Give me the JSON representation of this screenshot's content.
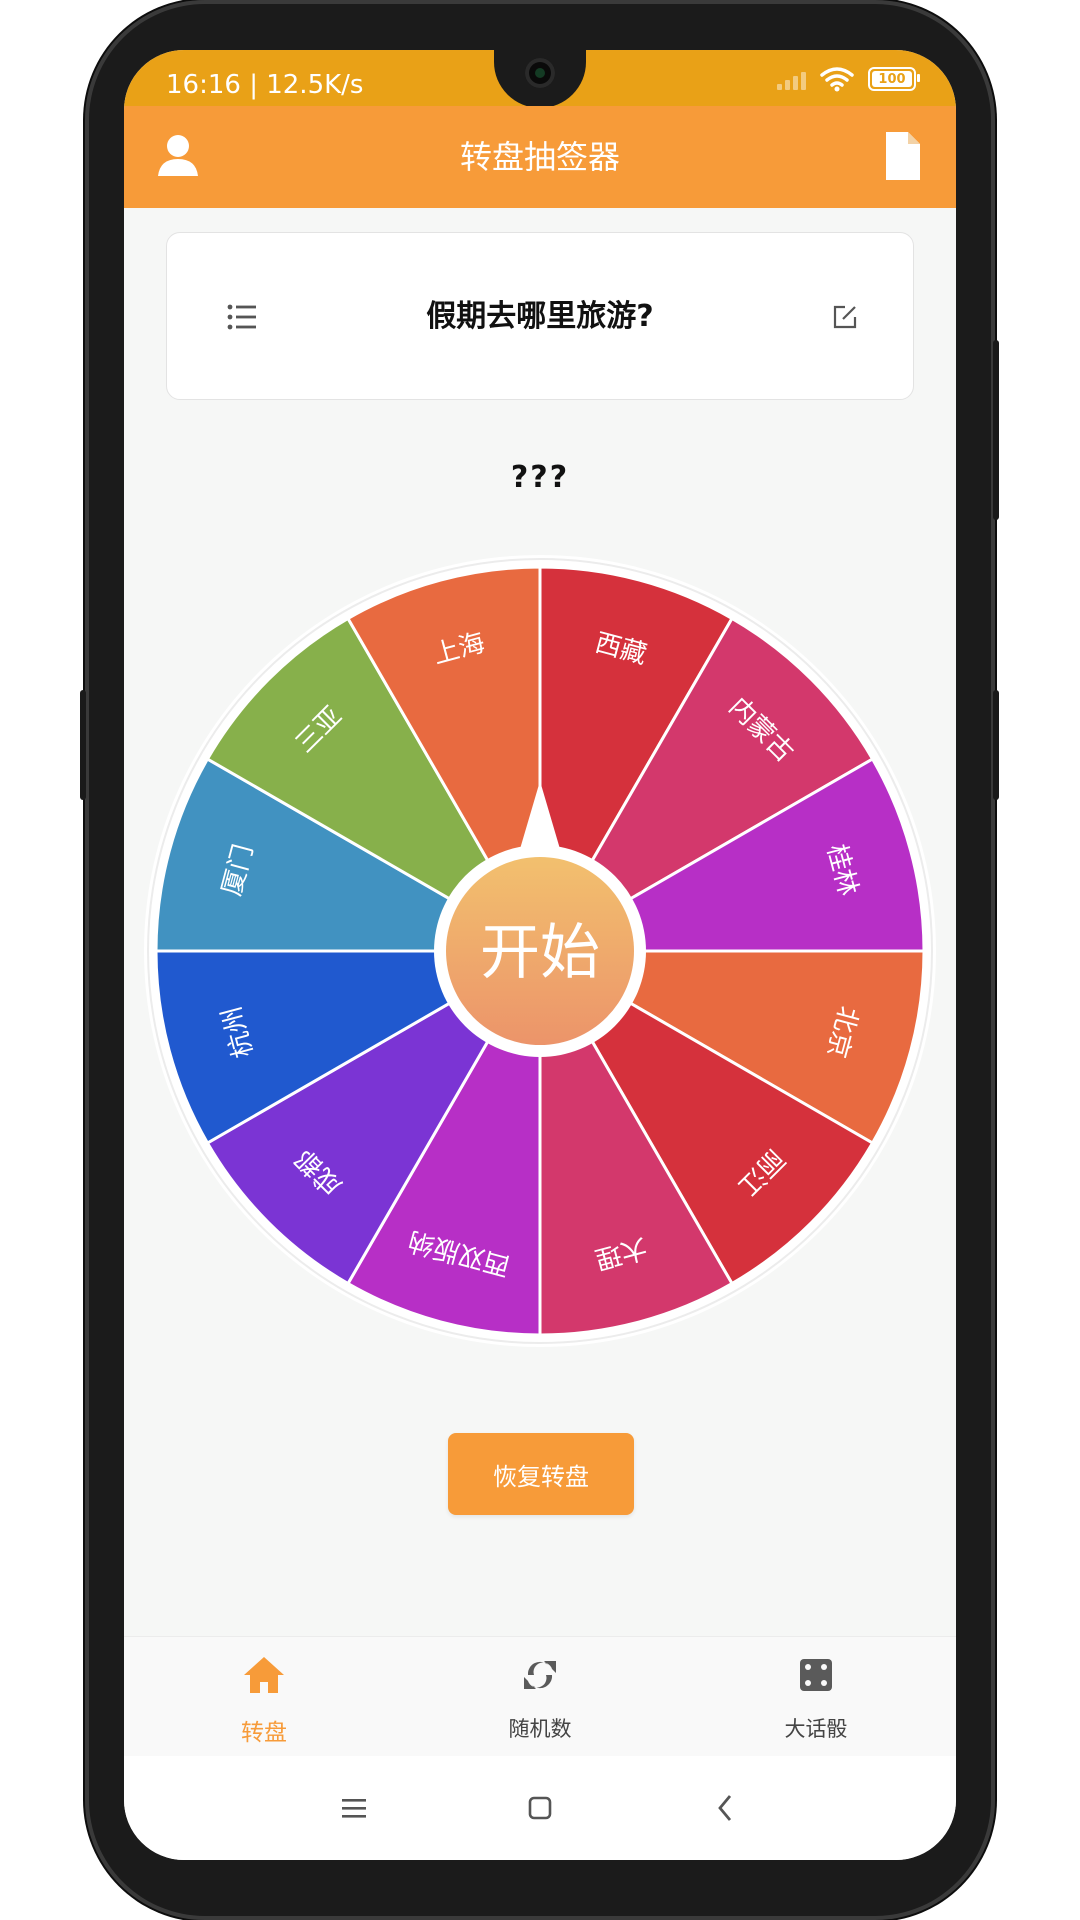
{
  "status_bar": {
    "time": "16:16 | 12.5K/s",
    "battery": "100"
  },
  "app_bar": {
    "title": "转盘抽签器",
    "left_icon": "user-icon",
    "right_icon": "document-icon"
  },
  "question_card": {
    "list_icon": "list-icon",
    "question": "假期去哪里旅游?",
    "edit_icon": "edit-icon"
  },
  "result": {
    "text": "???"
  },
  "wheel": {
    "center_label": "开始",
    "segments": [
      {
        "label": "西藏",
        "color": "#d5313c"
      },
      {
        "label": "内蒙古",
        "color": "#d3386c"
      },
      {
        "label": "桂林",
        "color": "#b72fc6"
      },
      {
        "label": "北京",
        "color": "#e86a40"
      },
      {
        "label": "丽江",
        "color": "#d5313c"
      },
      {
        "label": "大理",
        "color": "#d3386c"
      },
      {
        "label": "西双版纳",
        "color": "#b72fc6"
      },
      {
        "label": "成都",
        "color": "#7b34d4"
      },
      {
        "label": "杭州",
        "color": "#2059cf"
      },
      {
        "label": "厦门",
        "color": "#4192c1"
      },
      {
        "label": "三亚",
        "color": "#87b04b"
      },
      {
        "label": "上海",
        "color": "#e86a40"
      }
    ]
  },
  "restore_button": {
    "label": "恢复转盘"
  },
  "tabs": [
    {
      "label": "转盘",
      "icon": "home-icon",
      "active": true
    },
    {
      "label": "随机数",
      "icon": "refresh-icon",
      "active": false
    },
    {
      "label": "大话骰",
      "icon": "dice-icon",
      "active": false
    }
  ],
  "colors": {
    "primary": "#f79b39",
    "status_bar": "#e9a117",
    "center_button": "#f0a662"
  }
}
